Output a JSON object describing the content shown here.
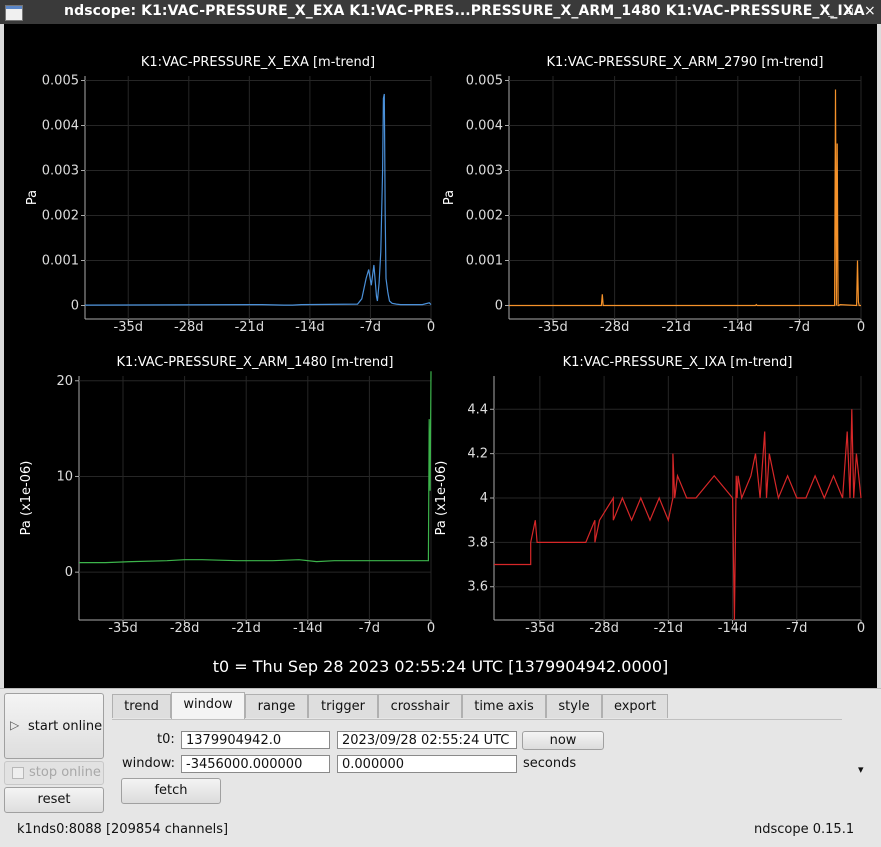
{
  "window": {
    "title": "ndscope: K1:VAC-PRESSURE_X_EXA K1:VAC-PRES...PRESSURE_X_ARM_1480 K1:VAC-PRESSURE_X_IXA",
    "min_glyph": "_",
    "max_glyph": "▫",
    "close_glyph": "×"
  },
  "plots": [
    {
      "title": "K1:VAC-PRESSURE_X_EXA [m-trend]",
      "ylabel": "Pa",
      "color": "#4a90d9",
      "yticks": [
        "0.005",
        "0.004",
        "0.003",
        "0.002",
        "0.001",
        "0"
      ],
      "xticks": [
        "-35d",
        "-28d",
        "-21d",
        "-14d",
        "-7d",
        "0"
      ],
      "chart_data": {
        "type": "line",
        "xlabel": "",
        "ylabel": "Pa",
        "xlim": [
          -40,
          0
        ],
        "ylim": [
          -0.0003,
          0.0051
        ],
        "x": [
          -40,
          -19.5,
          -17,
          -16,
          -15,
          -8.5,
          -8,
          -7.5,
          -7.2,
          -6.9,
          -6.6,
          -6.3,
          -6.2,
          -6.0,
          -5.8,
          -5.6,
          -5.5,
          -5.4,
          -5.3,
          -5.2,
          -5.0,
          -4.9,
          -4.8,
          -4.5,
          -4.0,
          -3.5,
          -3.0,
          -2.0,
          -1.0,
          -0.2,
          0
        ],
        "y": [
          1e-05,
          2e-05,
          1e-05,
          1e-05,
          2e-05,
          3e-05,
          0.00015,
          0.0006,
          0.0008,
          0.00045,
          0.0009,
          0.0002,
          0.0001,
          0.0005,
          0.0012,
          0.003,
          0.0046,
          0.0047,
          0.002,
          0.0006,
          0.0003,
          0.0002,
          0.0001,
          5e-05,
          3e-05,
          2e-05,
          2e-05,
          2e-05,
          2e-05,
          6e-05,
          2e-05
        ]
      }
    },
    {
      "title": "K1:VAC-PRESSURE_X_ARM_2790 [m-trend]",
      "ylabel": "Pa",
      "color": "#f5922a",
      "yticks": [
        "0.005",
        "0.004",
        "0.003",
        "0.002",
        "0.001",
        "0"
      ],
      "xticks": [
        "-35d",
        "-28d",
        "-21d",
        "-14d",
        "-7d",
        "0"
      ],
      "chart_data": {
        "type": "line",
        "xlabel": "",
        "ylabel": "Pa",
        "xlim": [
          -40,
          0
        ],
        "ylim": [
          -0.0003,
          0.0051
        ],
        "x": [
          -40,
          -29.5,
          -29.4,
          -29.3,
          -12,
          -11.9,
          -11.8,
          -3.0,
          -2.9,
          -2.8,
          -2.7,
          -2.6,
          -2.5,
          -2.4,
          -0.5,
          -0.4,
          -0.3,
          -0.2,
          0
        ],
        "y": [
          0.0,
          0.0,
          0.00025,
          0.0,
          0.0,
          2e-05,
          0.0,
          0.0,
          0.0048,
          0.0,
          0.0036,
          0.0,
          0.0,
          2e-05,
          0.0,
          0.001,
          8e-05,
          0.0,
          0.0
        ]
      }
    },
    {
      "title": "K1:VAC-PRESSURE_X_ARM_1480 [m-trend]",
      "ylabel": "Pa (x1e-06)",
      "color": "#3cb44b",
      "yticks": [
        "20",
        "10",
        "0"
      ],
      "xticks": [
        "-35d",
        "-28d",
        "-21d",
        "-14d",
        "-7d",
        "0"
      ],
      "chart_data": {
        "type": "line",
        "xlabel": "",
        "ylabel": "Pa (x1e-06)",
        "xlim": [
          -40,
          0
        ],
        "ylim": [
          -5,
          20.5
        ],
        "x": [
          -40,
          -37,
          -34,
          -30,
          -28,
          -26,
          -22,
          -18,
          -15,
          -13,
          -11,
          -8,
          -5,
          -3,
          -1,
          -0.3,
          -0.2,
          -0.1,
          0
        ],
        "y": [
          1.0,
          1.0,
          1.1,
          1.2,
          1.3,
          1.3,
          1.2,
          1.2,
          1.3,
          1.1,
          1.2,
          1.2,
          1.2,
          1.2,
          1.2,
          1.2,
          16,
          8.5,
          21
        ]
      }
    },
    {
      "title": "K1:VAC-PRESSURE_X_IXA [m-trend]",
      "ylabel": "Pa (x1e-06)",
      "color": "#d62728",
      "yticks": [
        "4.4",
        "4.2",
        "4",
        "3.8",
        "3.6"
      ],
      "xticks": [
        "-35d",
        "-28d",
        "-21d",
        "-14d",
        "-7d",
        "0"
      ],
      "chart_data": {
        "type": "line",
        "xlabel": "",
        "ylabel": "Pa (x1e-06)",
        "xlim": [
          -40,
          0
        ],
        "ylim": [
          3.45,
          4.55
        ],
        "x": [
          -40,
          -36,
          -36,
          -35.5,
          -35.3,
          -35,
          -34,
          -34,
          -30,
          -29,
          -29,
          -28.5,
          -28.5,
          -27,
          -27,
          -26,
          -25,
          -24,
          -23,
          -22,
          -21,
          -20.5,
          -20.5,
          -20.3,
          -20,
          -19,
          -18,
          -16,
          -14,
          -13.8,
          -13.6,
          -13.5,
          -13.4,
          -13,
          -12,
          -11.5,
          -11,
          -10.5,
          -10.3,
          -10,
          -9.5,
          -9,
          -8,
          -7,
          -6,
          -5,
          -4,
          -3,
          -2,
          -1.5,
          -1.2,
          -1,
          -0.8,
          -0.5,
          0
        ],
        "y": [
          3.7,
          3.7,
          3.8,
          3.9,
          3.8,
          3.8,
          3.8,
          3.8,
          3.8,
          3.9,
          3.8,
          3.9,
          3.9,
          4.0,
          3.9,
          4.0,
          3.9,
          4.0,
          3.9,
          4.0,
          3.9,
          4.0,
          4.2,
          4.0,
          4.1,
          4.0,
          4.0,
          4.1,
          4.0,
          3.45,
          4.1,
          4.0,
          4.1,
          4.0,
          4.1,
          4.2,
          4.0,
          4.3,
          4.0,
          4.2,
          4.1,
          4.0,
          4.1,
          4.0,
          4.0,
          4.1,
          4.0,
          4.1,
          4.0,
          4.3,
          4.0,
          4.4,
          4.0,
          4.2,
          4.0
        ]
      }
    }
  ],
  "t0_label": "t0 = Thu Sep 28 2023 02:55:24 UTC [1379904942.0000]",
  "controls": {
    "start_online": "start online",
    "start_glyph": "▷",
    "stop_online": "stop online",
    "reset": "reset",
    "tabs": [
      "trend",
      "window",
      "range",
      "trigger",
      "crosshair",
      "time axis",
      "style",
      "export"
    ],
    "active_tab": "window",
    "t0_label": "t0:",
    "t0_gps": "1379904942.0",
    "t0_utc": "2023/09/28 02:55:24 UTC",
    "now": "now",
    "window_label": "window:",
    "window_start": "-3456000.000000",
    "window_end": "0.000000",
    "seconds": "seconds",
    "fetch": "fetch",
    "dropdown_glyph": "▾"
  },
  "status": {
    "server": "k1nds0:8088",
    "channels": "[209854 channels]",
    "version": "ndscope 0.15.1"
  }
}
